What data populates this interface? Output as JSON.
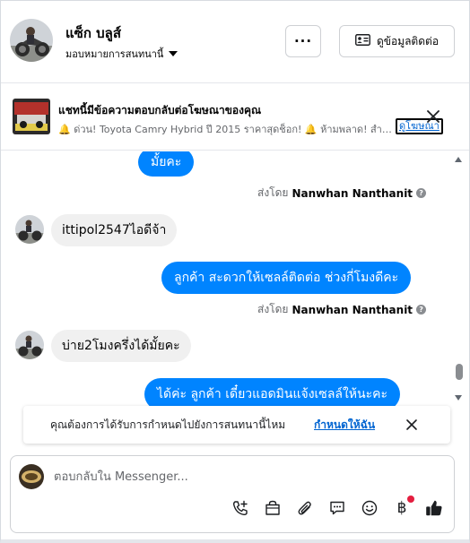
{
  "header": {
    "contact_name": "แซ็ก บลูส์",
    "assignment_label": "มอบหมายการสนทนานี้",
    "more_label": "···",
    "contact_info_label": "ดูข้อมูลติดต่อ"
  },
  "ad_banner": {
    "title": "แชทนี้มีข้อความตอบกลับต่อโฆษณาของคุณ",
    "preview": "🔔 ด่วน! Toyota Camry Hybrid ปี 2015 ราคาสุดช็อก! 🔔 ห้ามพลาด! สำ…",
    "view_ad_label": "ดูโฆษณา"
  },
  "messages": [
    {
      "direction": "out",
      "text": "มั้ยคะ"
    },
    {
      "direction": "meta",
      "prefix": "ส่งโดย",
      "sender": "Nanwhan Nanthanit"
    },
    {
      "direction": "in",
      "text": "ittipol2547ไอดีจ้า"
    },
    {
      "direction": "out",
      "text": "ลูกค้า สะดวกให้เซลล์ติดต่อ ช่วงกี่โมงดีคะ"
    },
    {
      "direction": "meta",
      "prefix": "ส่งโดย",
      "sender": "Nanwhan Nanthanit"
    },
    {
      "direction": "in",
      "text": "บ่าย2โมงครึ่งได้มั้ยคะ"
    },
    {
      "direction": "out",
      "text": "ได้ค่ะ  ลูกค้า   เดี๋ยวแอดมินแจ้งเซลล์ให้นะคะ"
    }
  ],
  "assign_prompt": {
    "text": "คุณต้องการได้รับการกำหนดไปยังการสนทนานี้ไหม",
    "link": "กำหนดให้ฉัน"
  },
  "composer": {
    "placeholder": "ตอบกลับใน Messenger...",
    "baht_symbol": "฿"
  },
  "icons": [
    "call-plus-icon",
    "shop-bag-icon",
    "paperclip-icon",
    "saved-reply-icon",
    "emoji-icon",
    "baht-icon",
    "thumbs-up-icon",
    "close-icon",
    "contact-card-icon",
    "chevron-down-icon",
    "help-icon"
  ],
  "colors": {
    "accent": "#0084ff",
    "link": "#0064d1",
    "incoming_bubble": "#f0f0f0",
    "notification": "#e41e3f"
  }
}
